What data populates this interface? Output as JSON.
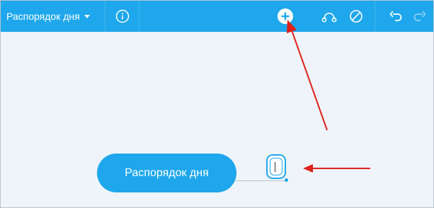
{
  "toolbar": {
    "title": "Распорядок дня",
    "buttons": [
      {
        "name": "dropdown-caret-icon"
      },
      {
        "name": "info-icon"
      },
      {
        "name": "add-icon"
      },
      {
        "name": "relationship-icon"
      },
      {
        "name": "no-style-icon"
      },
      {
        "name": "undo-icon"
      },
      {
        "name": "redo-icon"
      }
    ],
    "colors": {
      "background": "#1ea7ec",
      "icon": "#ffffff",
      "disabled_icon": "#8fd0f3"
    }
  },
  "canvas": {
    "background": "#eef4f9",
    "root_node": {
      "label": "Распорядок дня",
      "color": "#1ea7ec"
    },
    "child_node": {
      "label": "",
      "state": "editing"
    }
  },
  "annotations": {
    "arrow_color": "#e0201b",
    "count": 2
  }
}
